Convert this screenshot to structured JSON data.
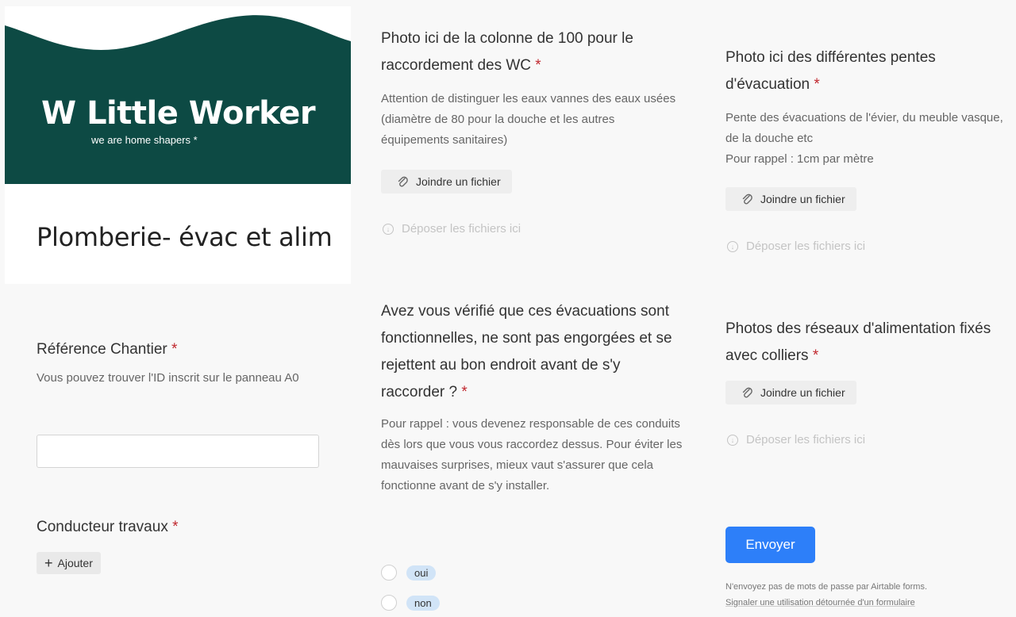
{
  "header": {
    "logo_text": "Little Worker",
    "logo_tagline": "we are home shapers *",
    "title": "Plomberie- évac et alim",
    "brand_color": "#0d4a44"
  },
  "fields": {
    "reference": {
      "label": "Référence Chantier",
      "required": "*",
      "help": "Vous pouvez trouver l'ID inscrit sur le panneau A0",
      "value": ""
    },
    "conducteur": {
      "label": "Conducteur travaux",
      "required": "*",
      "add_label": "Ajouter"
    },
    "photo_colonne": {
      "label": "Photo ici de la colonne de 100 pour le raccordement des WC",
      "required": "*",
      "help": "Attention de distinguer les eaux vannes des eaux usées (diamètre de 80 pour la douche et les autres équipements sanitaires)",
      "attach_label": "Joindre un fichier",
      "drop_label": "Déposer les fichiers ici"
    },
    "verif_evac": {
      "label": "Avez vous vérifié que ces évacuations sont fonctionnelles, ne sont pas engorgées et se rejettent au bon endroit avant de s'y raccorder ?",
      "required": "*",
      "help": "Pour rappel : vous devenez responsable de ces conduits dès lors que vous vous raccordez dessus. Pour éviter les mauvaises surprises, mieux vaut s'assurer que cela fonctionne avant de s'y installer.",
      "options": [
        "oui",
        "non"
      ]
    },
    "photo_pentes": {
      "label": "Photo ici des différentes pentes d'évacuation",
      "required": "*",
      "help_line1": "Pente des évacuations de l'évier, du meuble vasque, de la douche etc",
      "help_line2": "Pour rappel : 1cm par mètre",
      "attach_label": "Joindre un fichier",
      "drop_label": "Déposer les fichiers ici"
    },
    "photo_reseaux": {
      "label": "Photos des réseaux d'alimentation fixés avec colliers",
      "required": "*",
      "attach_label": "Joindre un fichier",
      "drop_label": "Déposer les fichiers ici"
    }
  },
  "submit": {
    "label": "Envoyer",
    "color": "#2d7ff9"
  },
  "footer": {
    "line1": "N'envoyez pas de mots de passe par Airtable forms.",
    "line2": "Signaler une utilisation détournée d'un formulaire"
  }
}
